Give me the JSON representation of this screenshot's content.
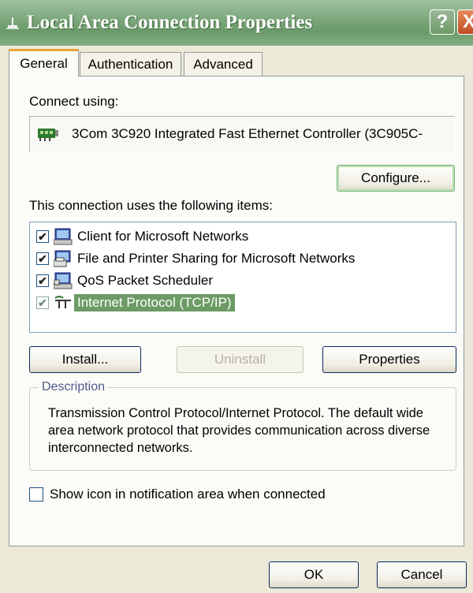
{
  "window": {
    "title": "Local Area Connection Properties",
    "help_label": "?",
    "close_label": "X"
  },
  "tabs": [
    {
      "label": "General",
      "active": true
    },
    {
      "label": "Authentication",
      "active": false
    },
    {
      "label": "Advanced",
      "active": false
    }
  ],
  "general": {
    "connect_using_label": "Connect using:",
    "adapter_name": "3Com 3C920 Integrated Fast Ethernet Controller (3C905C-",
    "configure_label": "Configure...",
    "items_label": "This connection uses the following items:",
    "items": [
      {
        "label": "Client for Microsoft Networks",
        "checked": true,
        "icon": "network-client-icon",
        "selected": false
      },
      {
        "label": "File and Printer Sharing for Microsoft Networks",
        "checked": true,
        "icon": "file-printer-sharing-icon",
        "selected": false
      },
      {
        "label": "QoS Packet Scheduler",
        "checked": true,
        "icon": "qos-scheduler-icon",
        "selected": false
      },
      {
        "label": "Internet Protocol (TCP/IP)",
        "checked": true,
        "icon": "protocol-icon",
        "selected": true
      }
    ],
    "install_label": "Install...",
    "uninstall_label": "Uninstall",
    "properties_label": "Properties",
    "description_title": "Description",
    "description_text": "Transmission Control Protocol/Internet Protocol. The default wide area network protocol that provides communication across diverse interconnected networks.",
    "show_icon_label": "Show icon in notification area when connected",
    "show_icon_checked": false
  },
  "footer": {
    "ok_label": "OK",
    "cancel_label": "Cancel"
  },
  "colors": {
    "titlebar": "#7aa57a",
    "selection": "#6d9b65",
    "dialog_bg": "#ece9d8",
    "active_tab_accent": "#e8a33a"
  }
}
